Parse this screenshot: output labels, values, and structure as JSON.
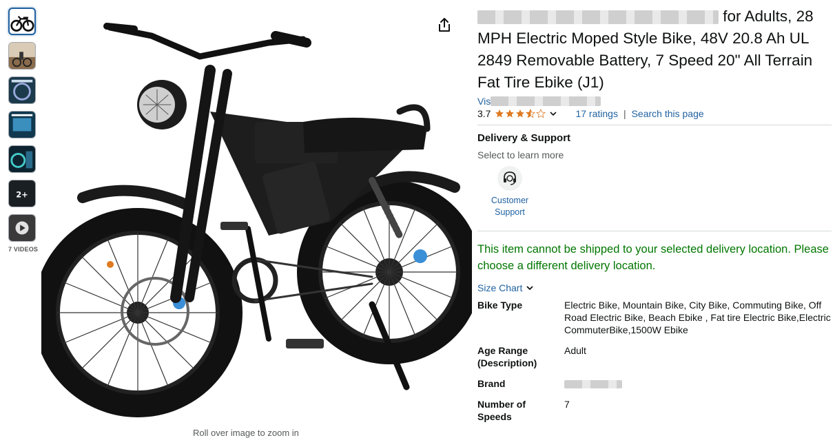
{
  "gallery": {
    "videos_label": "7 VIDEOS",
    "bottom_caption": "Roll over image to zoom in"
  },
  "product": {
    "title_visible": "for Adults, 28 MPH Electric Moped Style Bike, 48V 20.8 Ah UL 2849 Removable Battery, 7 Speed 20\" All Terrain Fat Tire Ebike (J1)",
    "store_prefix": "Vis",
    "rating_value": "3.7",
    "ratings_count": "17 ratings",
    "rating_separator": "|",
    "search_link": "Search this page"
  },
  "support": {
    "heading": "Delivery & Support",
    "subtext": "Select to learn more",
    "customer_support_line1": "Customer",
    "customer_support_line2": "Support"
  },
  "delivery_warning": "This item cannot be shipped to your selected delivery location. Please choose a different delivery location.",
  "size_chart": "Size Chart",
  "specs": [
    {
      "key": "Bike Type",
      "value": "Electric Bike, Mountain Bike, City Bike, Commuting Bike, Off Road Electric Bike, Beach Ebike , Fat tire Electric Bike,Electric CommuterBike,1500W Ebike"
    },
    {
      "key": "Age Range (Description)",
      "value": "Adult"
    },
    {
      "key": "Brand",
      "value": ""
    },
    {
      "key": "Number of Speeds",
      "value": "7"
    }
  ],
  "colors": {
    "link": "#2162a1",
    "star": "#de7921",
    "warning": "#007600"
  }
}
